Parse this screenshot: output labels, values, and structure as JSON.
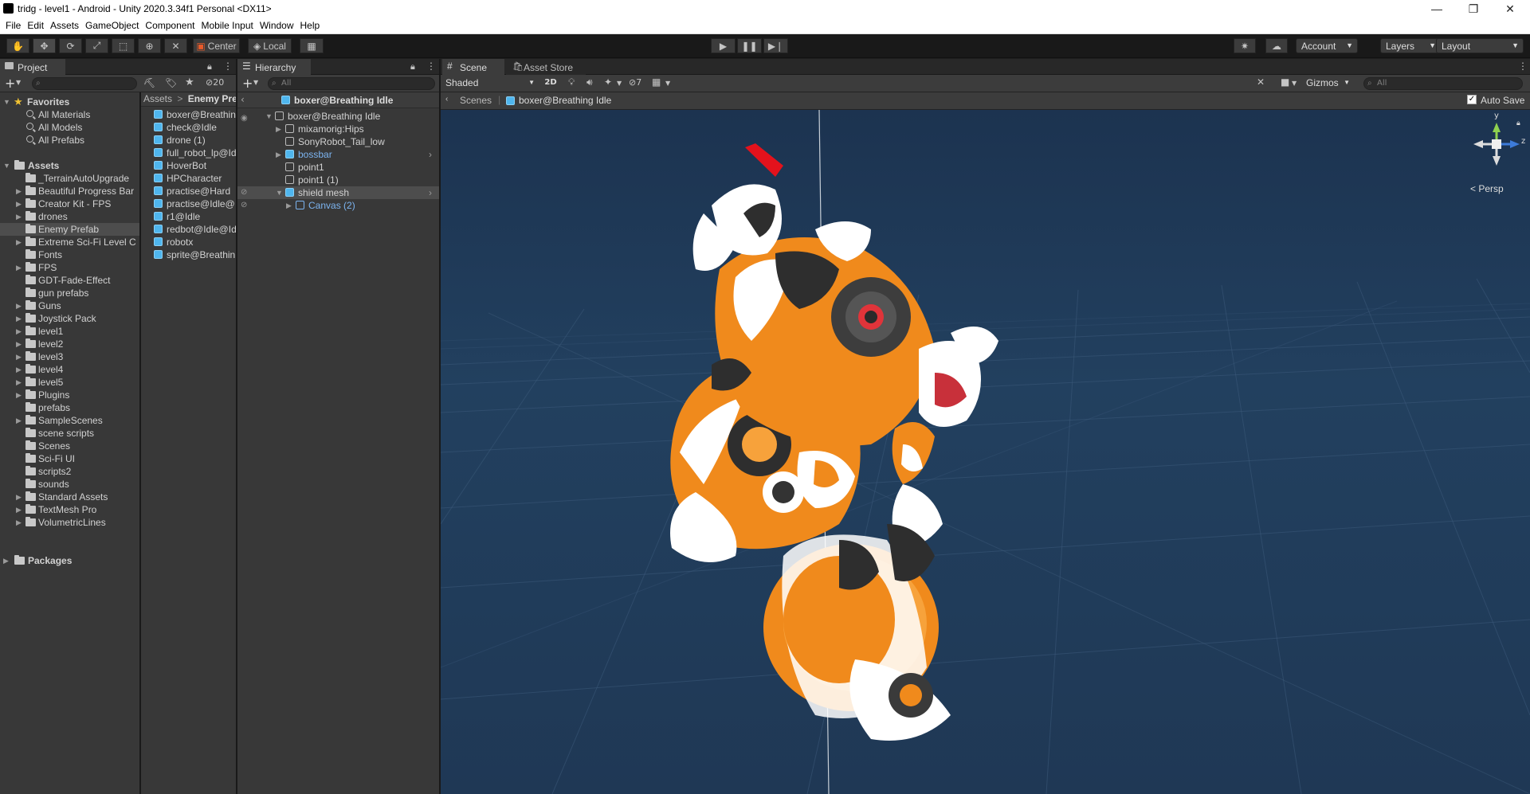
{
  "window": {
    "title": "tridg - level1 - Android - Unity 2020.3.34f1 Personal <DX11>",
    "controls": [
      "—",
      "❐",
      "✕"
    ]
  },
  "menu": [
    "File",
    "Edit",
    "Assets",
    "GameObject",
    "Component",
    "Mobile Input",
    "Window",
    "Help"
  ],
  "toolbar": {
    "pivot_label": "Center",
    "space_label": "Local",
    "account_label": "Account",
    "layers_label": "Layers",
    "layout_label": "Layout"
  },
  "project": {
    "tab_label": "Project",
    "hidden_count": "20",
    "favorites_label": "Favorites",
    "favorites": [
      "All Materials",
      "All Models",
      "All Prefabs"
    ],
    "assets_label": "Assets",
    "folders": [
      "_TerrainAutoUpgrade",
      "Beautiful Progress Bar",
      "Creator Kit - FPS",
      "drones",
      "Enemy Prefab",
      "Extreme Sci-Fi Level C",
      "Fonts",
      "FPS",
      "GDT-Fade-Effect",
      "gun prefabs",
      "Guns",
      "Joystick Pack",
      "level1",
      "level2",
      "level3",
      "level4",
      "level5",
      "Plugins",
      "prefabs",
      "SampleScenes",
      "scene scripts",
      "Scenes",
      "Sci-Fi UI",
      "scripts2",
      "sounds",
      "Standard Assets",
      "TextMesh Pro",
      "VolumetricLines"
    ],
    "packages_label": "Packages",
    "breadcrumb_root": "Assets",
    "breadcrumb_sep": ">",
    "breadcrumb_current": "Enemy Pre",
    "items": [
      "boxer@Breathin",
      "check@Idle",
      "drone (1)",
      "full_robot_lp@Id",
      "HoverBot",
      "HPCharacter",
      "practise@Hard",
      "practise@Idle@",
      "r1@Idle",
      "redbot@Idle@Id",
      "robotx",
      "sprite@Breathin"
    ]
  },
  "hierarchy": {
    "tab_label": "Hierarchy",
    "search_placeholder": "All",
    "prefab_header": "boxer@Breathing Idle",
    "root": "boxer@Breathing Idle",
    "children": [
      "mixamorig:Hips",
      "SonyRobot_Tail_low",
      "bossbar",
      "point1",
      "point1 (1)",
      "shield mesh"
    ],
    "grandchild": "Canvas (2)"
  },
  "scene": {
    "tab_label": "Scene",
    "asset_store_label": "Asset Store",
    "draw_mode": "Shaded",
    "mode_2d": "2D",
    "hidden_count": "7",
    "gizmos_label": "Gizmos",
    "search_placeholder": "All",
    "breadcrumb_root": "Scenes",
    "breadcrumb_current": "boxer@Breathing Idle",
    "auto_save_label": "Auto Save",
    "projection_label": "Persp",
    "axis_y": "y",
    "axis_z": "z"
  },
  "colors": {
    "scene_bg": "#1f3855",
    "robot_orange": "#f08a1c",
    "prefab_blue": "#4fb6ee"
  }
}
